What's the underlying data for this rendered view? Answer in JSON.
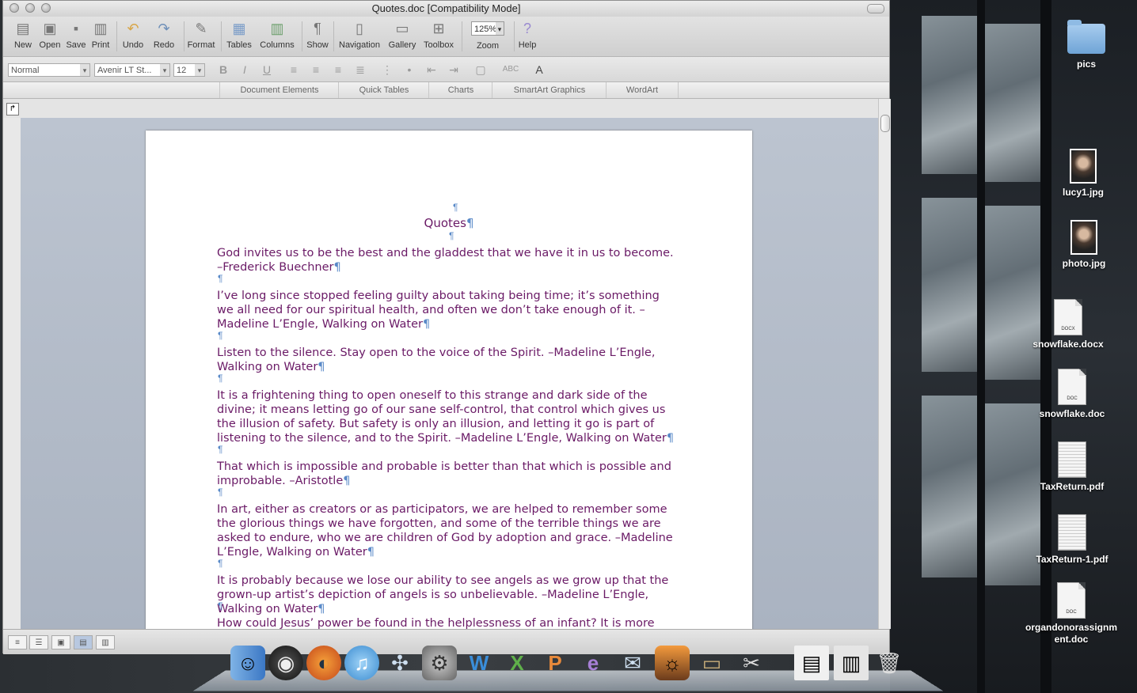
{
  "window": {
    "title": "Quotes.doc [Compatibility Mode]"
  },
  "toolbar": {
    "new": "New",
    "open": "Open",
    "save": "Save",
    "print": "Print",
    "undo": "Undo",
    "redo": "Redo",
    "format": "Format",
    "tables": "Tables",
    "columns": "Columns",
    "show": "Show",
    "navigation": "Navigation",
    "gallery": "Gallery",
    "toolbox": "Toolbox",
    "zoom_value": "125%",
    "zoom": "Zoom",
    "help": "Help"
  },
  "formatting": {
    "style": "Normal",
    "font": "Avenir LT St...",
    "size": "12",
    "bold": "B",
    "italic": "I",
    "underline": "U"
  },
  "ribbon": {
    "tabs": [
      "Document Elements",
      "Quick Tables",
      "Charts",
      "SmartArt Graphics",
      "WordArt"
    ]
  },
  "document": {
    "pilcrow": "¶",
    "title": "Quotes",
    "paragraphs": [
      "God invites us to be the best and the gladdest that we have it in us to become. –Frederick Buechner",
      "I’ve long since stopped feeling guilty about taking being time; it’s something we all need for our spiritual health, and often we don’t take enough of it. –Madeline L’Engle, Walking on Water",
      "Listen to the silence. Stay open to the voice of the Spirit. –Madeline L’Engle, Walking on Water",
      "It is a frightening thing to open oneself to this strange and dark side of the divine; it means letting go of our sane self-control, that control which gives us the illusion of safety. But safety is only an illusion, and letting it go is part of listening to the silence, and to the Spirit. –Madeline L’Engle, Walking on Water",
      "That which is impossible and probable is better than that which is possible and improbable. –Aristotle",
      "In art, either as creators or as participators, we are helped to remember some the glorious things we have forgotten, and some of the terrible things we are asked to endure, who we are children of God by adoption and grace. –Madeline L’Engle, Walking on Water",
      "It is probably because we lose our ability to see angels as we grow up that the grown-up artist’s depiction of angels is so unbelievable. –Madeline L’Engle, Walking on Water",
      "How could Jesus’ power be found in the helplessness of an infant? It is more than we,"
    ]
  },
  "desktop": {
    "icons": [
      {
        "label": "pics"
      },
      {
        "label": "lucy1.jpg"
      },
      {
        "label": "photo.jpg"
      },
      {
        "label": "snowflake.docx",
        "tag": "DOCX"
      },
      {
        "label": "snowflake.doc",
        "tag": "DOC"
      },
      {
        "label": "TaxReturn.pdf"
      },
      {
        "label": "TaxReturn-1.pdf"
      },
      {
        "label": "organdonorassignment.doc",
        "tag": "DOC"
      }
    ]
  },
  "colors": {
    "text": "#6a1a66",
    "pilcrow": "#5a8ac8"
  }
}
